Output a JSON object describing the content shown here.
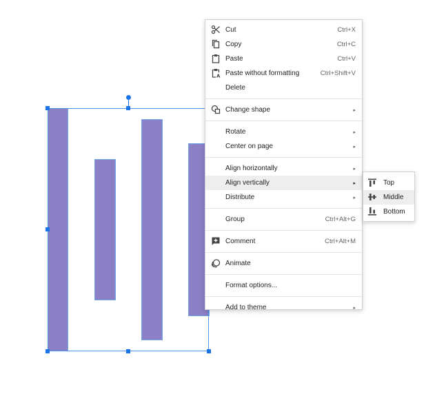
{
  "canvas": {
    "shape_fill": "#8b7fc6",
    "selection_color": "#1a73e8"
  },
  "context_menu": {
    "cut": {
      "label": "Cut",
      "shortcut": "Ctrl+X",
      "icon": "scissors-icon"
    },
    "copy": {
      "label": "Copy",
      "shortcut": "Ctrl+C",
      "icon": "copy-icon"
    },
    "paste": {
      "label": "Paste",
      "shortcut": "Ctrl+V",
      "icon": "clipboard-icon"
    },
    "paste_plain": {
      "label": "Paste without formatting",
      "shortcut": "Ctrl+Shift+V",
      "icon": "clipboard-text-icon"
    },
    "delete": {
      "label": "Delete"
    },
    "change_shape": {
      "label": "Change shape",
      "icon": "shapes-icon"
    },
    "rotate": {
      "label": "Rotate"
    },
    "center_on_page": {
      "label": "Center on page"
    },
    "align_horizontally": {
      "label": "Align horizontally"
    },
    "align_vertically": {
      "label": "Align vertically"
    },
    "distribute": {
      "label": "Distribute"
    },
    "group": {
      "label": "Group",
      "shortcut": "Ctrl+Alt+G"
    },
    "comment": {
      "label": "Comment",
      "shortcut": "Ctrl+Alt+M",
      "icon": "add-comment-icon"
    },
    "animate": {
      "label": "Animate",
      "icon": "animate-icon"
    },
    "format_options": {
      "label": "Format options..."
    },
    "add_to_theme": {
      "label": "Add to theme"
    },
    "arrow_glyph": "▸"
  },
  "submenu": {
    "top": {
      "label": "Top",
      "icon": "align-top-icon"
    },
    "middle": {
      "label": "Middle",
      "icon": "align-middle-icon"
    },
    "bottom": {
      "label": "Bottom",
      "icon": "align-bottom-icon"
    }
  }
}
